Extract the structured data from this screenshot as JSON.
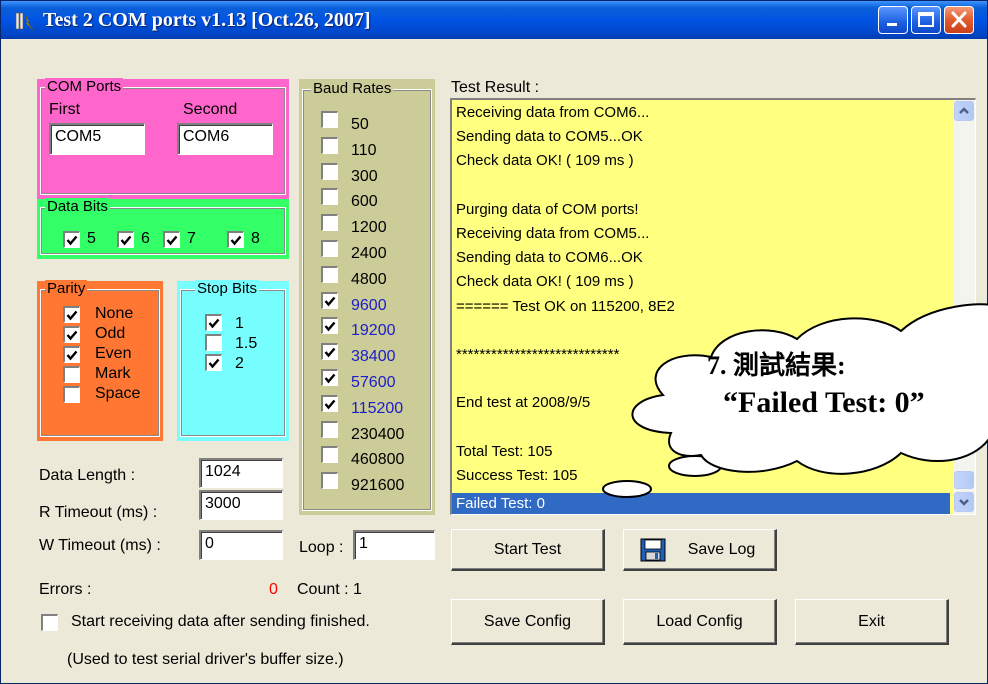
{
  "window": {
    "title": "Test 2 COM ports v1.13 [Oct.26, 2007]"
  },
  "com_ports": {
    "legend": "COM Ports",
    "first_label": "First",
    "second_label": "Second",
    "first_value": "COM5",
    "second_value": "COM6"
  },
  "data_bits": {
    "legend": "Data Bits",
    "options": [
      {
        "label": "5",
        "checked": true
      },
      {
        "label": "6",
        "checked": true
      },
      {
        "label": "7",
        "checked": true
      },
      {
        "label": "8",
        "checked": true
      }
    ]
  },
  "parity": {
    "legend": "Parity",
    "options": [
      {
        "label": "None",
        "checked": true
      },
      {
        "label": "Odd",
        "checked": true
      },
      {
        "label": "Even",
        "checked": true
      },
      {
        "label": "Mark",
        "checked": false
      },
      {
        "label": "Space",
        "checked": false
      }
    ]
  },
  "stop_bits": {
    "legend": "Stop Bits",
    "options": [
      {
        "label": "1",
        "checked": true
      },
      {
        "label": "1.5",
        "checked": false
      },
      {
        "label": "2",
        "checked": true
      }
    ]
  },
  "baud_rates": {
    "legend": "Baud Rates",
    "options": [
      {
        "label": "50",
        "checked": false
      },
      {
        "label": "110",
        "checked": false
      },
      {
        "label": "300",
        "checked": false
      },
      {
        "label": "600",
        "checked": false
      },
      {
        "label": "1200",
        "checked": false
      },
      {
        "label": "2400",
        "checked": false
      },
      {
        "label": "4800",
        "checked": false
      },
      {
        "label": "9600",
        "checked": true
      },
      {
        "label": "19200",
        "checked": true
      },
      {
        "label": "38400",
        "checked": true
      },
      {
        "label": "57600",
        "checked": true
      },
      {
        "label": "115200",
        "checked": true
      },
      {
        "label": "230400",
        "checked": false
      },
      {
        "label": "460800",
        "checked": false
      },
      {
        "label": "921600",
        "checked": false
      }
    ]
  },
  "params": {
    "data_length_label": "Data Length :",
    "data_length_value": "1024",
    "r_timeout_label": "R Timeout (ms) :",
    "r_timeout_value": "3000",
    "w_timeout_label": "W Timeout (ms) :",
    "w_timeout_value": "0",
    "loop_label": "Loop :",
    "loop_value": "1",
    "errors_label": "Errors :",
    "errors_value": "0",
    "count_label": "Count : 1"
  },
  "options": {
    "start_after_send_label": "Start receiving data after sending finished.",
    "start_after_send_checked": false,
    "note": "(Used to test serial driver's buffer size.)"
  },
  "test_result": {
    "label": "Test Result :",
    "lines": [
      "Receiving data from COM6...",
      "Sending data to COM5...OK",
      "Check data OK! ( 109 ms )",
      "",
      "Purging data of COM ports!",
      "Receiving data from COM5...",
      "Sending data to COM6...OK",
      "Check data OK! ( 109 ms )",
      "====== Test OK on 115200, 8E2",
      "",
      "****************************",
      "",
      "End test at 2008/9/5",
      "",
      "Total Test: 105",
      "Success Test: 105"
    ],
    "selected_line": "Failed Test: 0"
  },
  "buttons": {
    "start_test": "Start Test",
    "save_log": "Save Log",
    "save_config": "Save Config",
    "load_config": "Load Config",
    "exit": "Exit"
  },
  "callout": {
    "line1": "7. 測試結果:",
    "line2": "“Failed Test: 0”"
  },
  "colors": {
    "com_ports_bg": "#ff66cc",
    "data_bits_bg": "#33ff66",
    "parity_bg": "#ff7733",
    "stop_bits_bg": "#77ffff",
    "baud_bg": "#cccc99",
    "log_bg": "#ffff80",
    "baud_checked_text": "#1c1cc8",
    "error_red": "#ff0000"
  }
}
